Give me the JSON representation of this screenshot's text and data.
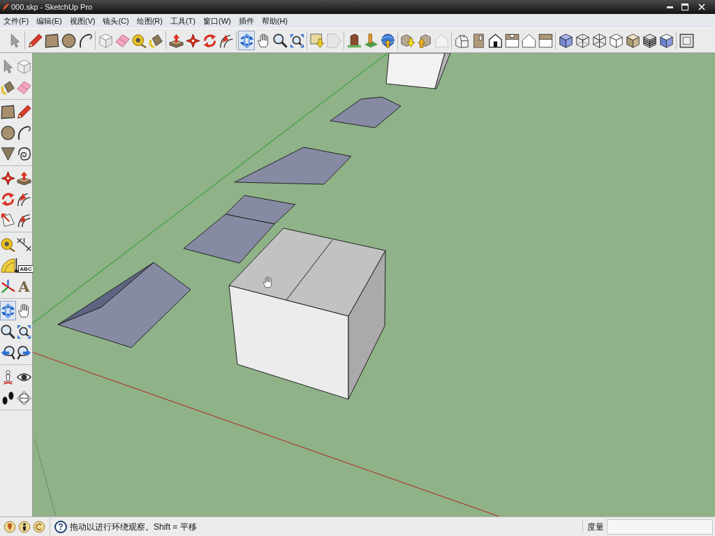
{
  "window": {
    "title": "000.skp - SketchUp Pro"
  },
  "menu": [
    "文件(F)",
    "编辑(E)",
    "视图(V)",
    "镜头(C)",
    "绘图(R)",
    "工具(T)",
    "窗口(W)",
    "插件",
    "帮助(H)"
  ],
  "toolbar": [
    {
      "tools": [
        {
          "kind": "select",
          "selected": false
        }
      ]
    },
    {
      "tools": [
        {
          "kind": "pencil",
          "selected": false
        },
        {
          "kind": "rectangle",
          "selected": false
        },
        {
          "kind": "circle",
          "selected": false
        },
        {
          "kind": "arc",
          "selected": false
        }
      ]
    },
    {
      "tools": [
        {
          "kind": "component",
          "selected": false
        },
        {
          "kind": "eraser",
          "selected": false
        },
        {
          "kind": "tape",
          "selected": false
        },
        {
          "kind": "paint",
          "selected": false
        }
      ]
    },
    {
      "tools": [
        {
          "kind": "pushpull",
          "selected": false
        },
        {
          "kind": "move",
          "selected": false
        },
        {
          "kind": "rotate",
          "selected": false
        },
        {
          "kind": "followme",
          "selected": false
        }
      ]
    },
    {
      "tools": [
        {
          "kind": "orbit",
          "selected": true
        },
        {
          "kind": "pan",
          "selected": false
        },
        {
          "kind": "zoom",
          "selected": false
        },
        {
          "kind": "zoomextents",
          "selected": false
        }
      ]
    },
    {
      "tools": [
        {
          "kind": "getmodels",
          "selected": false
        },
        {
          "kind": "sharemodel",
          "selected": false
        }
      ]
    },
    {
      "tools": [
        {
          "kind": "building",
          "selected": false
        },
        {
          "kind": "placemodel",
          "selected": false
        },
        {
          "kind": "earth",
          "selected": false
        }
      ]
    },
    {
      "tools": [
        {
          "kind": "getcomponent",
          "selected": false
        },
        {
          "kind": "sharecomponent",
          "selected": false
        },
        {
          "kind": "greyhouse",
          "selected": false
        }
      ]
    },
    {
      "tools": [
        {
          "kind": "iso",
          "selected": false
        },
        {
          "kind": "top",
          "selected": false
        },
        {
          "kind": "front",
          "selected": false
        },
        {
          "kind": "right",
          "selected": false
        },
        {
          "kind": "back",
          "selected": false
        },
        {
          "kind": "left",
          "selected": false
        }
      ]
    },
    {
      "tools": [
        {
          "kind": "xray",
          "selected": false
        },
        {
          "kind": "backedges",
          "selected": false
        },
        {
          "kind": "wireframe",
          "selected": false
        },
        {
          "kind": "hiddenline",
          "selected": false
        },
        {
          "kind": "shaded",
          "selected": false
        },
        {
          "kind": "textured",
          "selected": false
        },
        {
          "kind": "monochrome",
          "selected": false
        }
      ]
    },
    {
      "tools": [
        {
          "kind": "frame",
          "selected": false
        }
      ]
    }
  ],
  "side_toolbar": [
    {
      "tools": [
        {
          "kind": "select",
          "selected": false
        },
        {
          "kind": "component",
          "selected": false
        },
        {
          "kind": "paint",
          "selected": false
        },
        {
          "kind": "eraser",
          "selected": false
        }
      ]
    },
    {
      "tools": [
        {
          "kind": "rectangle",
          "selected": false
        },
        {
          "kind": "pencil",
          "selected": false
        },
        {
          "kind": "circle",
          "selected": false
        },
        {
          "kind": "arc",
          "selected": false
        },
        {
          "kind": "polygon",
          "selected": false
        },
        {
          "kind": "freehand",
          "selected": false
        }
      ]
    },
    {
      "tools": [
        {
          "kind": "move",
          "selected": false
        },
        {
          "kind": "pushpull",
          "selected": false
        },
        {
          "kind": "rotate",
          "selected": false
        },
        {
          "kind": "followme",
          "selected": false
        },
        {
          "kind": "scale",
          "selected": false
        },
        {
          "kind": "offset",
          "selected": false
        }
      ]
    },
    {
      "tools": [
        {
          "kind": "tape",
          "selected": false
        },
        {
          "kind": "dimension",
          "selected": false
        },
        {
          "kind": "protractor",
          "selected": false
        },
        {
          "kind": "text",
          "label": "ABC",
          "selected": false
        },
        {
          "kind": "axes",
          "selected": false
        },
        {
          "kind": "text3d",
          "label": "A",
          "selected": false
        }
      ]
    },
    {
      "tools": [
        {
          "kind": "orbit",
          "selected": true
        },
        {
          "kind": "pan",
          "selected": false
        },
        {
          "kind": "zoom",
          "selected": false
        },
        {
          "kind": "zoomextents",
          "selected": false
        },
        {
          "kind": "previous",
          "selected": false
        },
        {
          "kind": "next",
          "selected": false
        }
      ]
    },
    {
      "tools": [
        {
          "kind": "position",
          "selected": false
        },
        {
          "kind": "lookaround",
          "selected": false
        },
        {
          "kind": "walk",
          "selected": false
        },
        {
          "kind": "section",
          "selected": false
        }
      ]
    }
  ],
  "status_bar": {
    "help": "?",
    "hint": "拖动以进行环绕观察。Shift = 平移",
    "measure_label": "度量"
  }
}
